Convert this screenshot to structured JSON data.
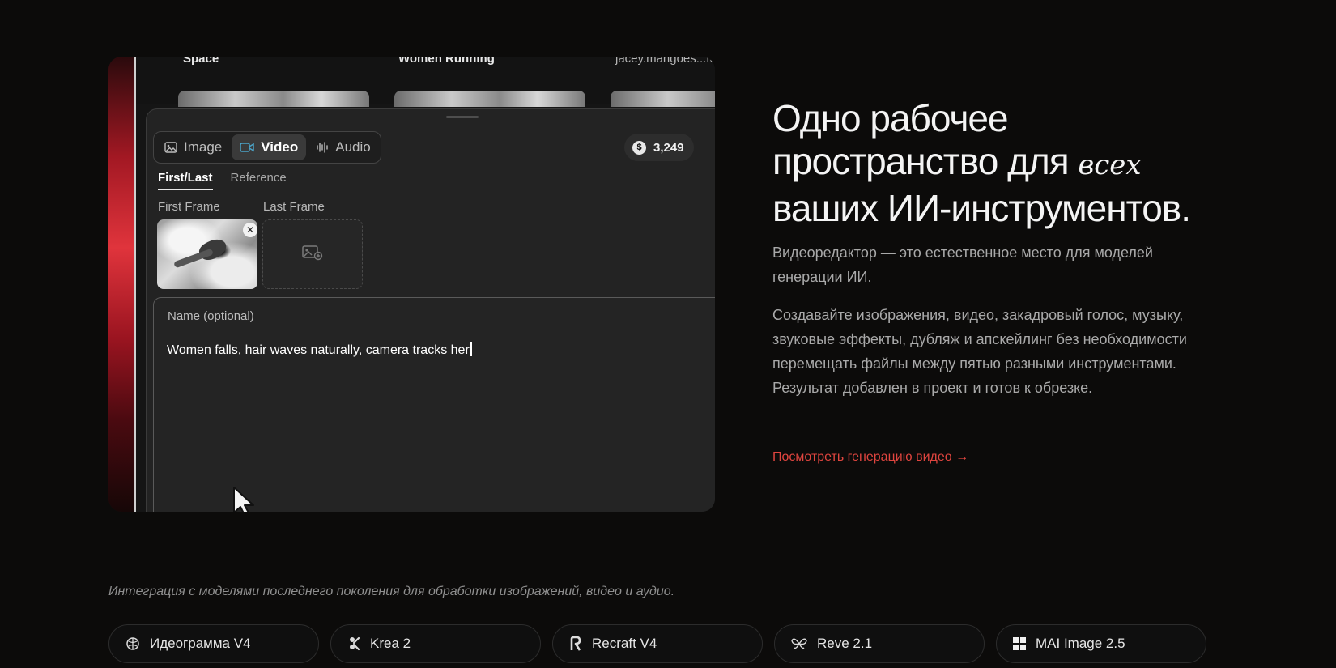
{
  "preview": {
    "top_thumbnails": [
      {
        "label": "Space"
      },
      {
        "label": "Women Running"
      },
      {
        "label": "jacey.mangoes...force"
      }
    ],
    "modes": [
      {
        "label": "Image",
        "icon": "image-icon",
        "active": false
      },
      {
        "label": "Video",
        "icon": "video-icon",
        "active": true
      },
      {
        "label": "Audio",
        "icon": "audio-wave-icon",
        "active": false
      }
    ],
    "credits": {
      "symbol": "$",
      "value": "3,249"
    },
    "subtabs": [
      {
        "label": "First/Last",
        "active": true
      },
      {
        "label": "Reference",
        "active": false
      }
    ],
    "first_frame_label": "First Frame",
    "last_frame_label": "Last Frame",
    "close_symbol": "✕",
    "prompt": {
      "label": "Name (optional)",
      "text": "Women falls, hair waves naturally, camera tracks her"
    }
  },
  "headline": {
    "line1": "Одно рабочее",
    "line2a": "пространство для ",
    "line2b_italic": "всех",
    "line3": "ваших ИИ-инструментов."
  },
  "paragraphs": [
    "Видеоредактор — это естественное место для моделей генерации ИИ.",
    "Создавайте изображения, видео, закадровый голос, музыку, звуковые эффекты, дубляж и апскейлинг без необходимости перемещать файлы между пятью разными инструментами. Результат добавлен в проект и готов к обрезке."
  ],
  "link": "Посмотреть генерацию видео →",
  "colors": {
    "accent_link": "#e0453f",
    "background": "#0c0b0a"
  },
  "integration_note": "Интеграция с моделями последнего поколения для обработки изображений, видео и аудио.",
  "models": [
    {
      "label": "Идеограмма V4",
      "icon": "ideogram-icon"
    },
    {
      "label": "Krea 2",
      "icon": "krea-icon"
    },
    {
      "label": "Recraft V4",
      "icon": "recraft-icon"
    },
    {
      "label": "Reve 2.1",
      "icon": "reve-icon"
    },
    {
      "label": "MAI Image 2.5",
      "icon": "windows-grid-icon"
    }
  ]
}
